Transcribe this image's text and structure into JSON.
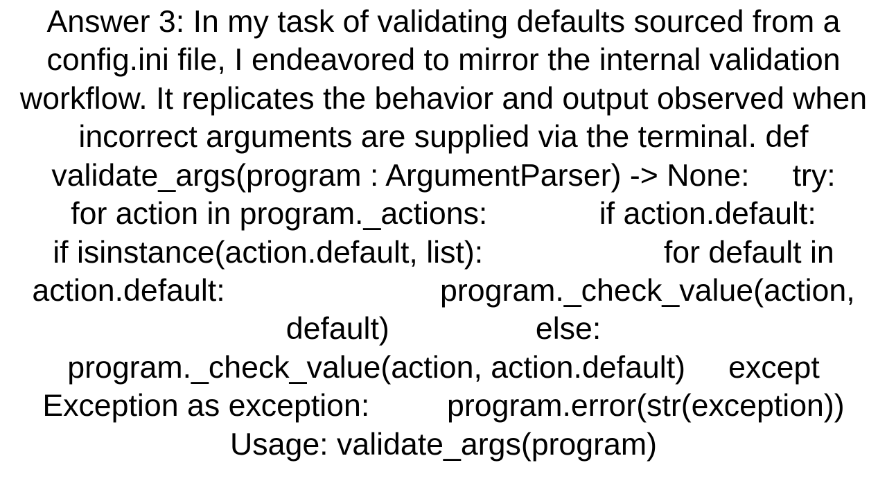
{
  "document": {
    "body_text": "Answer 3: In my task of validating defaults sourced from a config.ini file, I endeavored to mirror the internal validation workflow. It replicates the behavior and output observed when incorrect arguments are supplied via the terminal. def validate_args(program : ArgumentParser) -> None:     try:         for action in program._actions:             if action.default:                 if isinstance(action.default, list):                     for default in action.default:                         program._check_value(action, default)                 else:                     program._check_value(action, action.default)     except Exception as exception:         program.error(str(exception))  Usage: validate_args(program)"
  }
}
